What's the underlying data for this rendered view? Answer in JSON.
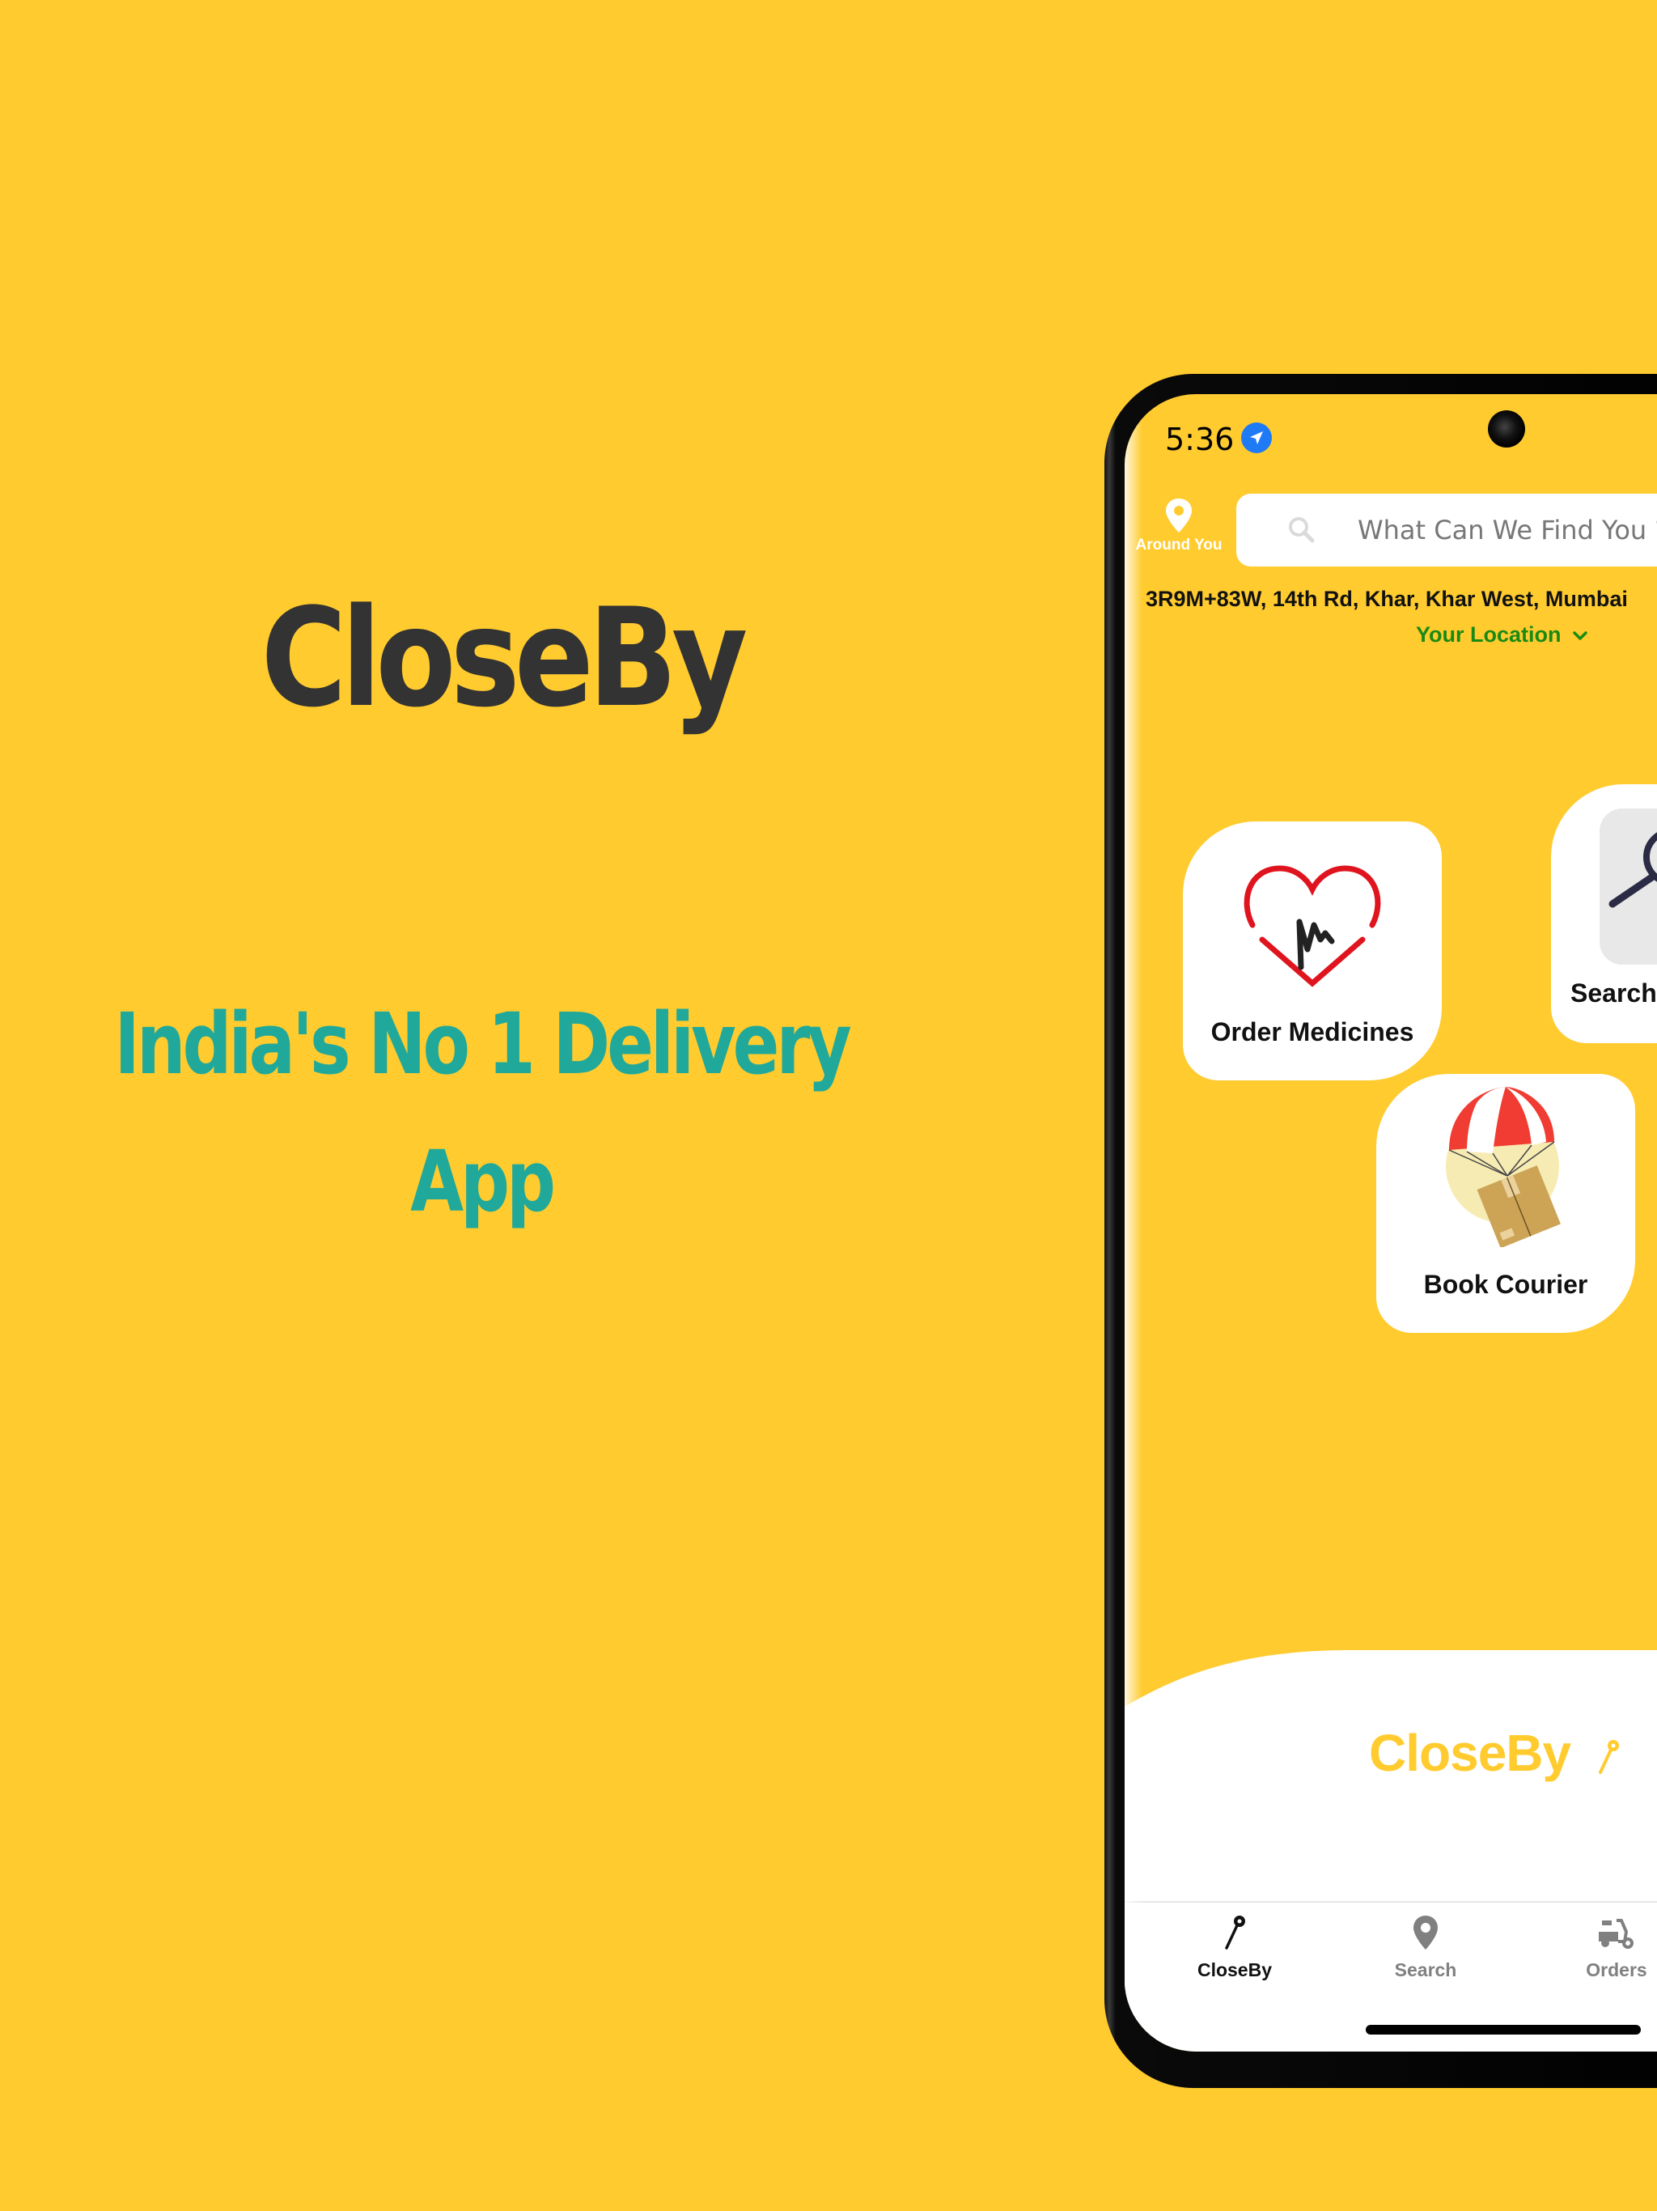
{
  "marketing": {
    "title": "CloseBy",
    "tagline_line1": "India's No 1 Delivery",
    "tagline_line2": "App",
    "title_color": "#333333",
    "tagline_color": "#20A99A",
    "background_color": "#FFCB2F"
  },
  "status_bar": {
    "time": "5:36",
    "location_icon": "location-arrow-icon"
  },
  "header": {
    "around_you_label": "Around You",
    "search_placeholder": "What Can We Find You ?",
    "search_icon": "search-icon",
    "address": "3R9M+83W, 14th Rd, Khar, Khar West, Mumbai",
    "location_selector_label": "Your Location",
    "location_selector_color": "#1A8A14"
  },
  "services": [
    {
      "label": "Order Medicines",
      "icon": "heart-pulse-icon"
    },
    {
      "label": "Search",
      "icon": "magnifier-icon"
    },
    {
      "label": "Book Courier",
      "icon": "parachute-package-icon"
    }
  ],
  "brand_footer": {
    "text": "CloseBy",
    "icon": "pin-icon",
    "color": "#FFCB2F"
  },
  "tab_bar": {
    "tabs": [
      {
        "label": "CloseBy",
        "icon": "pin-icon",
        "active": true
      },
      {
        "label": "Search",
        "icon": "map-marker-icon",
        "active": false
      },
      {
        "label": "Orders",
        "icon": "scooter-icon",
        "active": false
      }
    ]
  }
}
